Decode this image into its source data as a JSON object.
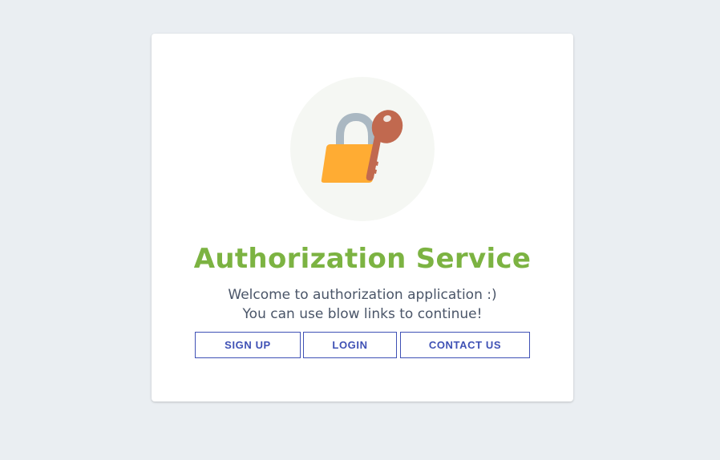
{
  "auth": {
    "title": "Authorization Service",
    "welcome_line1": "Welcome to authorization application :)",
    "welcome_line2": "You can use blow links to continue!",
    "icon": "lock-with-key-icon",
    "buttons": {
      "signup": "SIGN UP",
      "login": "LOGIN",
      "contact": "CONTACT US"
    }
  },
  "colors": {
    "page_bg": "#eaeef2",
    "card_bg": "#ffffff",
    "title": "#7cb342",
    "text": "#4a5568",
    "button_accent": "#3f51b5",
    "lock_body": "#ffac33",
    "lock_shackle": "#aab8c2",
    "key": "#c1694f"
  }
}
